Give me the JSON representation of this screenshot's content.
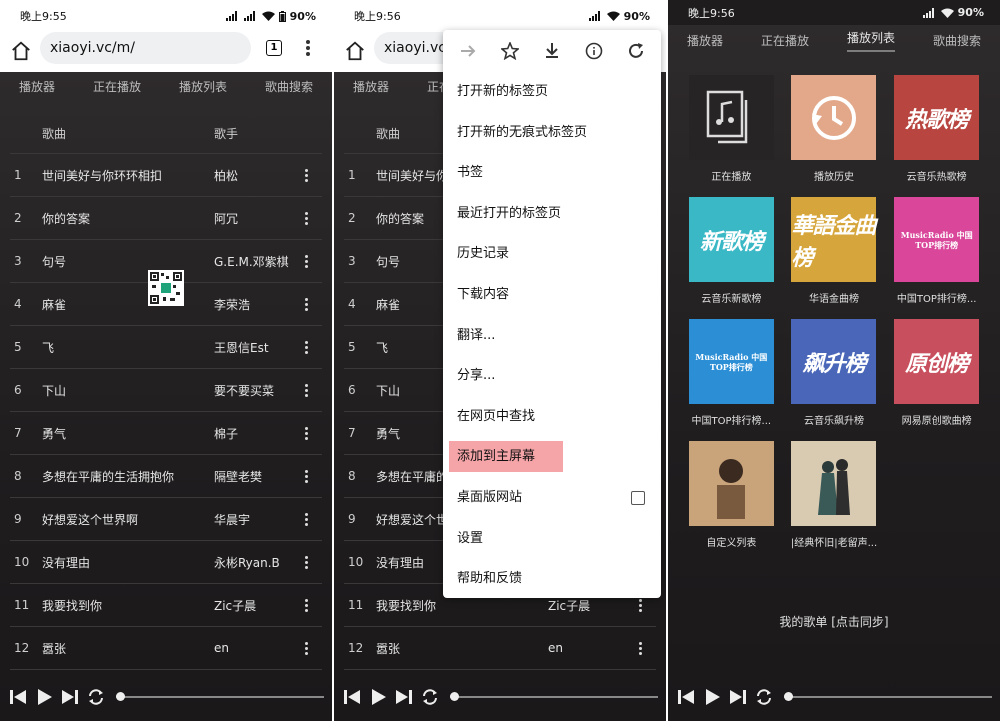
{
  "status": {
    "time1": "晚上9:55",
    "time2": "晚上9:56",
    "time3": "晚上9:56",
    "battery": "90%"
  },
  "browser": {
    "url": "xiaoyi.vc/m/",
    "url_short": "xiaoyi.vc/",
    "tab_count": "1"
  },
  "nav_tabs": [
    "播放器",
    "正在播放",
    "播放列表",
    "歌曲搜索"
  ],
  "table": {
    "header_song": "歌曲",
    "header_artist": "歌手",
    "rows": [
      {
        "num": "1",
        "song": "世间美好与你环环相扣",
        "artist": "柏松"
      },
      {
        "num": "2",
        "song": "你的答案",
        "artist": "阿冗"
      },
      {
        "num": "3",
        "song": "句号",
        "artist": "G.E.M.邓紫棋"
      },
      {
        "num": "4",
        "song": "麻雀",
        "artist": "李荣浩"
      },
      {
        "num": "5",
        "song": "飞",
        "artist": "王恩信Est"
      },
      {
        "num": "6",
        "song": "下山",
        "artist": "要不要买菜"
      },
      {
        "num": "7",
        "song": "勇气",
        "artist": "棉子"
      },
      {
        "num": "8",
        "song": "多想在平庸的生活拥抱你",
        "artist": "隔壁老樊"
      },
      {
        "num": "9",
        "song": "好想爱这个世界啊",
        "artist": "华晨宇"
      },
      {
        "num": "10",
        "song": "没有理由",
        "artist": "永彬Ryan.B"
      },
      {
        "num": "11",
        "song": "我要找到你",
        "artist": "Zic子晨"
      },
      {
        "num": "12",
        "song": "嚣张",
        "artist": "en"
      }
    ],
    "rows_p2": [
      {
        "num": "1",
        "song": "世间美好与你",
        "artist": ""
      },
      {
        "num": "2",
        "song": "你的答案",
        "artist": ""
      },
      {
        "num": "3",
        "song": "句号",
        "artist": ""
      },
      {
        "num": "4",
        "song": "麻雀",
        "artist": ""
      },
      {
        "num": "5",
        "song": "飞",
        "artist": ""
      },
      {
        "num": "6",
        "song": "下山",
        "artist": ""
      },
      {
        "num": "7",
        "song": "勇气",
        "artist": ""
      },
      {
        "num": "8",
        "song": "多想在平庸的",
        "artist": ""
      },
      {
        "num": "9",
        "song": "好想爱这个世",
        "artist": ""
      },
      {
        "num": "10",
        "song": "没有理由",
        "artist": ""
      },
      {
        "num": "11",
        "song": "我要找到你",
        "artist": "Zic子晨"
      },
      {
        "num": "12",
        "song": "嚣张",
        "artist": "en"
      }
    ]
  },
  "menu": {
    "items": [
      "打开新的标签页",
      "打开新的无痕式标签页",
      "书签",
      "最近打开的标签页",
      "历史记录",
      "下载内容",
      "翻译...",
      "分享...",
      "在网页中查找",
      "添加到主屏幕",
      "桌面版网站",
      "设置",
      "帮助和反馈"
    ]
  },
  "playlists": {
    "tiles": [
      {
        "label": "正在播放",
        "cover_text": "",
        "color": "#262425"
      },
      {
        "label": "播放历史",
        "cover_text": "",
        "color": "#e3a88a"
      },
      {
        "label": "云音乐热歌榜",
        "cover_text": "热歌榜",
        "color": "#b8453f"
      },
      {
        "label": "云音乐新歌榜",
        "cover_text": "新歌榜",
        "color": "#3bb8c6"
      },
      {
        "label": "华语金曲榜",
        "cover_text": "華語金曲榜",
        "color": "#d6a63d"
      },
      {
        "label": "中国TOP排行榜...",
        "cover_text": "MusicRadio 中国TOP排行榜",
        "color": "#d9469a"
      },
      {
        "label": "中国TOP排行榜...",
        "cover_text": "MusicRadio 中国TOP排行榜",
        "color": "#2c8fd6"
      },
      {
        "label": "云音乐飙升榜",
        "cover_text": "飙升榜",
        "color": "#4a66b8"
      },
      {
        "label": "网易原创歌曲榜",
        "cover_text": "原创榜",
        "color": "#c8505e"
      },
      {
        "label": "自定义列表",
        "cover_text": "",
        "color": "#c9a37a"
      },
      {
        "label": "|经典怀旧|老留声...",
        "cover_text": "",
        "color": "#d8cbb1"
      }
    ],
    "sync_text": "我的歌单 [点击同步]"
  }
}
